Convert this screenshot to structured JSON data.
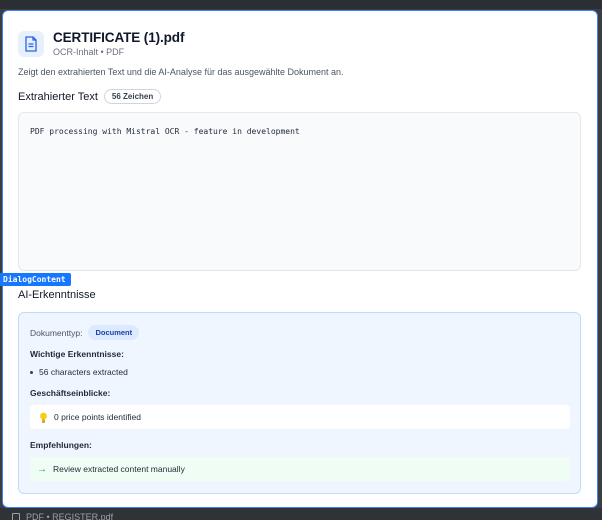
{
  "dialog": {
    "title": "CERTIFICATE (1).pdf",
    "subtitle": "OCR-Inhalt • PDF",
    "description": "Zeigt den extrahierten Text und die AI-Analyse für das ausgewählte Dokument an.",
    "file_icon": "document-icon"
  },
  "extracted": {
    "heading": "Extrahierter Text",
    "char_count_badge": "56 Zeichen",
    "content": "PDF processing with Mistral OCR - feature in development"
  },
  "analysis": {
    "heading": "AI-Erkenntnisse",
    "doc_type_label": "Dokumenttyp:",
    "doc_type_value": "Document",
    "key_insights_label": "Wichtige Erkenntnisse:",
    "key_insights": [
      "56 characters extracted"
    ],
    "business_label": "Geschäftseinblicke:",
    "business_insights": [
      "0 price points identified"
    ],
    "business_icon": "lightbulb-icon",
    "recommendations_label": "Empfehlungen:",
    "recommendations": [
      "Review extracted content manually"
    ],
    "recommendation_arrow": "→"
  },
  "debug_overlay": {
    "label": "DialogContent"
  },
  "background": {
    "partial_file_name": "PDF • REGISTER.pdf"
  },
  "colors": {
    "accent": "#3b82f6",
    "analysis_bg": "#eff6ff",
    "chip_bg": "#dbeafe",
    "recommendation_bg": "#f0fdf4",
    "debug_tag": "#1677ff"
  }
}
